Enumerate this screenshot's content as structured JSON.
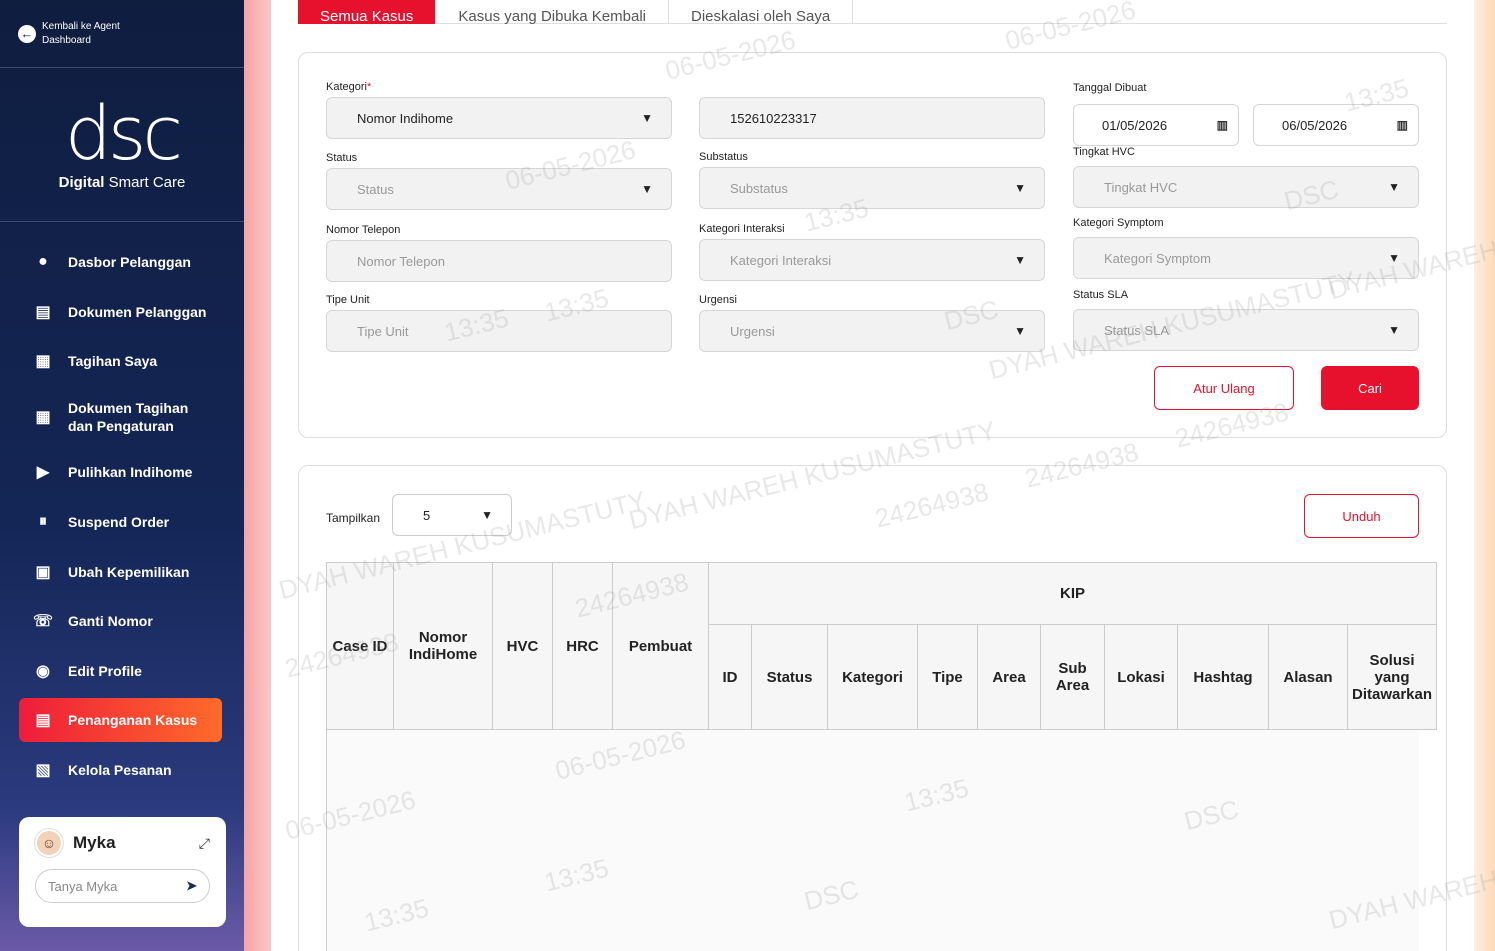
{
  "sidebar": {
    "back_label_1": "Kembali ke Agent",
    "back_label_2": "Dashboard",
    "brand_logo": "dsc",
    "brand_bold": "Digital",
    "brand_rest": " Smart Care",
    "items": [
      {
        "label": "Dasbor Pelanggan",
        "icon": "user-circle-icon"
      },
      {
        "label": "Dokumen Pelanggan",
        "icon": "document-icon"
      },
      {
        "label": "Tagihan Saya",
        "icon": "bill-icon"
      },
      {
        "label": "Dokumen Tagihan dan Pengaturan",
        "icon": "bill-settings-icon"
      },
      {
        "label": "Pulihkan Indihome",
        "icon": "play-icon"
      },
      {
        "label": "Suspend Order",
        "icon": "suspend-icon"
      },
      {
        "label": "Ubah Kepemilikan",
        "icon": "ownership-icon"
      },
      {
        "label": "Ganti Nomor",
        "icon": "change-number-icon"
      },
      {
        "label": "Edit Profile",
        "icon": "profile-icon"
      },
      {
        "label": "Penanganan Kasus",
        "icon": "case-icon",
        "active": true
      },
      {
        "label": "Kelola Pesanan",
        "icon": "order-icon"
      }
    ],
    "myka": {
      "name": "Myka",
      "placeholder": "Tanya Myka"
    }
  },
  "tabs": [
    "Semua Kasus",
    "Kasus yang Dibuka Kembali",
    "Dieskalasi oleh Saya"
  ],
  "filters": {
    "kategori": {
      "label": "Kategori",
      "required": "*",
      "value": "Nomor Indihome"
    },
    "nomor_value": "152610223317",
    "tanggal": {
      "label": "Tanggal Dibuat",
      "from": "01/05/2026",
      "to": "06/05/2026"
    },
    "status": {
      "label": "Status",
      "placeholder": "Status"
    },
    "substatus": {
      "label": "Substatus",
      "placeholder": "Substatus"
    },
    "hvc": {
      "label": "Tingkat HVC",
      "placeholder": "Tingkat HVC"
    },
    "telepon": {
      "label": "Nomor Telepon",
      "placeholder": "Nomor Telepon"
    },
    "interaksi": {
      "label": "Kategori Interaksi",
      "placeholder": "Kategori Interaksi"
    },
    "symptom": {
      "label": "Kategori Symptom",
      "placeholder": "Kategori Symptom"
    },
    "tipe_unit": {
      "label": "Tipe Unit",
      "placeholder": "Tipe Unit"
    },
    "urgensi": {
      "label": "Urgensi",
      "placeholder": "Urgensi"
    },
    "sla": {
      "label": "Status SLA",
      "placeholder": "Status SLA"
    },
    "reset_label": "Atur Ulang",
    "search_label": "Cari"
  },
  "table": {
    "show_label": "Tampilkan",
    "show_value": "5",
    "download_label": "Unduh",
    "headers": [
      "Case ID",
      "Nomor IndiHome",
      "HVC",
      "HRC",
      "Pembuat"
    ],
    "group_header": "KIP",
    "sub_headers": [
      "ID",
      "Status",
      "Kategori",
      "Tipe",
      "Area",
      "Sub Area",
      "Lokasi",
      "Hashtag",
      "Alasan",
      "Solusi yang Ditawarkan"
    ]
  },
  "watermark": {
    "date": "06-05-2026",
    "time": "13:35",
    "org": "DSC",
    "name": "DYAH WAREH KUSUMASTUTY",
    "id": "24264938"
  },
  "colors": {
    "accent": "#e8112d",
    "sidebar": "#0f1d3f"
  }
}
